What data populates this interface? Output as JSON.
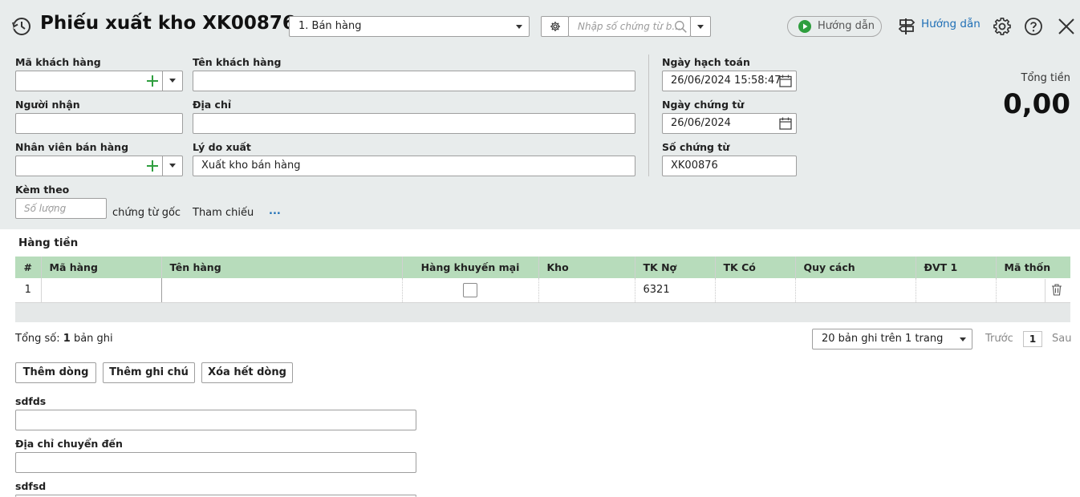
{
  "header": {
    "title": "Phiếu xuất kho XK00876",
    "type_select": "1. Bán hàng",
    "search_placeholder": "Nhập số chứng từ b...",
    "guide_video_label": "Hướng dẫn",
    "guide_label": "Hướng dẫn"
  },
  "form": {
    "customer_code_label": "Mã khách hàng",
    "customer_name_label": "Tên khách hàng",
    "receiver_label": "Người nhận",
    "address_label": "Địa chỉ",
    "sales_staff_label": "Nhân viên bán hàng",
    "reason_label": "Lý do xuất",
    "reason_value": "Xuất kho bán hàng",
    "attach_label": "Kèm theo",
    "attach_placeholder": "Số lượng",
    "attach_suffix": "chứng từ gốc",
    "reference_label": "Tham chiếu",
    "reference_more": "..."
  },
  "dates": {
    "posting_date_label": "Ngày hạch toán",
    "posting_date_value": "26/06/2024 15:58:47",
    "doc_date_label": "Ngày chứng từ",
    "doc_date_value": "26/06/2024",
    "doc_no_label": "Số chứng từ",
    "doc_no_value": "XK00876"
  },
  "total": {
    "label": "Tổng tiền",
    "value": "0,00"
  },
  "grid": {
    "section_title": "Hàng tiền",
    "columns": [
      "#",
      "Mã hàng",
      "Tên hàng",
      "Hàng khuyến mại",
      "Kho",
      "TK Nợ",
      "TK Có",
      "Quy cách",
      "ĐVT 1",
      "Mã thốn"
    ],
    "rows": [
      {
        "index": "1",
        "code": "",
        "name": "",
        "promo": false,
        "warehouse": "",
        "debit": "6321",
        "credit": "",
        "spec": "",
        "unit": "",
        "stock_code": ""
      }
    ]
  },
  "pagination": {
    "total_prefix": "Tổng số: ",
    "total_count": "1",
    "total_suffix": " bản ghi",
    "page_size": "20 bản ghi trên 1 trang",
    "prev": "Trước",
    "page": "1",
    "next": "Sau"
  },
  "actions": {
    "add_row": "Thêm dòng",
    "add_note": "Thêm ghi chú",
    "delete_all": "Xóa hết dòng"
  },
  "extra_fields": {
    "f1_label": "sdfds",
    "f2_label": "Địa chỉ chuyển đến",
    "f3_label": "sdfsd"
  },
  "colors": {
    "header_bg": "#e8ecec",
    "grid_header": "#b7dcbb",
    "accent_green": "#2e9e3e",
    "link_blue": "#1f6fb6"
  }
}
